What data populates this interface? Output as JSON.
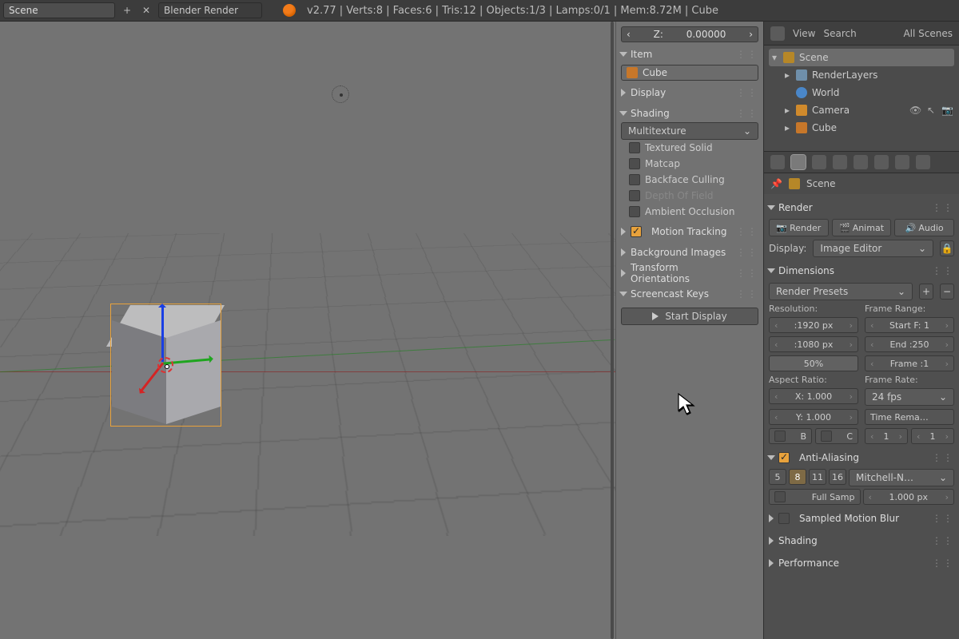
{
  "topbar": {
    "scene_name": "Scene",
    "render_engine": "Blender Render",
    "stats": "v2.77 | Verts:8 | Faces:6 | Tris:12 | Objects:1/3 | Lamps:0/1 | Mem:8.72M | Cube"
  },
  "n_panel": {
    "transform_z": {
      "label": "Z:",
      "value": "0.00000"
    },
    "item": {
      "header": "Item",
      "name": "Cube"
    },
    "display": {
      "header": "Display"
    },
    "shading": {
      "header": "Shading",
      "mode": "Multitexture",
      "textured_solid": "Textured Solid",
      "matcap": "Matcap",
      "backface": "Backface Culling",
      "dof": "Depth Of Field",
      "ao": "Ambient Occlusion"
    },
    "motion_tracking": "Motion Tracking",
    "background_images": "Background Images",
    "transform_orient": "Transform Orientations",
    "screencast": {
      "header": "Screencast Keys",
      "button": "Start Display"
    }
  },
  "outliner": {
    "view": "View",
    "search": "Search",
    "all_scenes": "All Scenes",
    "scene": "Scene",
    "renderlayers": "RenderLayers",
    "world": "World",
    "camera": "Camera",
    "cube": "Cube"
  },
  "properties": {
    "context_scene_name": "Scene",
    "render": {
      "header": "Render",
      "render_btn": "Render",
      "anim_btn": "Animat",
      "audio_btn": "Audio",
      "display_label": "Display:",
      "display_value": "Image Editor"
    },
    "dimensions": {
      "header": "Dimensions",
      "presets": "Render Presets",
      "res_label": "Resolution:",
      "range_label": "Frame Range:",
      "res_x": ":1920 px",
      "start_f": "Start F: 1",
      "res_y": ":1080 px",
      "end_f": "End :250",
      "pct": "50%",
      "frame": "Frame :1",
      "aspect_label": "Aspect Ratio:",
      "rate_label": "Frame Rate:",
      "ax": "X: 1.000",
      "fps": "24 fps",
      "ay": "Y: 1.000",
      "remap": "Time Rema…",
      "border": "B",
      "crop": "C",
      "old": "1",
      "new": "1"
    },
    "aa": {
      "header": "Anti-Aliasing",
      "s5": "5",
      "s8": "8",
      "s11": "11",
      "s16": "16",
      "filter": "Mitchell-N…",
      "full_sample": "Full Samp",
      "size": "1.000 px"
    },
    "sampled_motion_blur": "Sampled Motion Blur",
    "shading": "Shading",
    "performance": "Performance"
  }
}
